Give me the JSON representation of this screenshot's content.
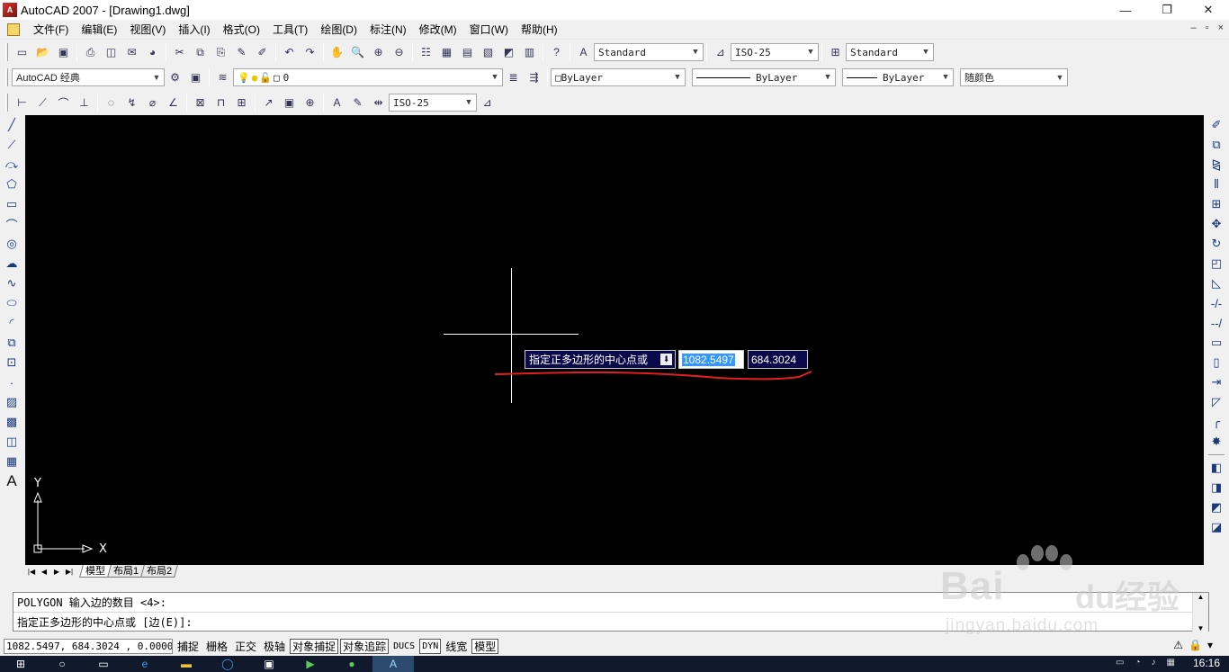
{
  "window": {
    "title": "AutoCAD 2007 - [Drawing1.dwg]",
    "logo_text": "A",
    "minimize": "—",
    "maximize": "❐",
    "close": "✕"
  },
  "menubar": {
    "items": [
      "文件(F)",
      "编辑(E)",
      "视图(V)",
      "插入(I)",
      "格式(O)",
      "工具(T)",
      "绘图(D)",
      "标注(N)",
      "修改(M)",
      "窗口(W)",
      "帮助(H)"
    ],
    "mdi": [
      "–",
      "▫",
      "×"
    ]
  },
  "toolbar": {
    "text_style": "Standard",
    "dim_style": "ISO-25",
    "table_style": "Standard",
    "workspace": "AutoCAD 经典",
    "layer": "0",
    "color": "ByLayer",
    "linetype": "ByLayer",
    "lineweight": "ByLayer",
    "plot_style": "随颜色",
    "dim_style2": "ISO-25"
  },
  "canvas": {
    "dyn_prompt": "指定正多边形的中心点或",
    "dyn_x": "1082.5497",
    "dyn_y": "684.3024",
    "ucs_x": "X",
    "ucs_y": "Y",
    "annotation_color": "#e02020",
    "background": "#000000"
  },
  "tabs": {
    "nav": [
      "|◀",
      "◀",
      "▶",
      "▶|"
    ],
    "items": [
      "模型",
      "布局1",
      "布局2"
    ],
    "active": "模型"
  },
  "command": {
    "line1": "POLYGON 输入边的数目 <4>:",
    "line2": "指定正多边形的中心点或 [边(E)]:"
  },
  "status": {
    "coords": "1082.5497, 684.3024 , 0.0000",
    "toggles": [
      {
        "label": "捕捉",
        "on": false
      },
      {
        "label": "栅格",
        "on": false
      },
      {
        "label": "正交",
        "on": false
      },
      {
        "label": "极轴",
        "on": false
      },
      {
        "label": "对象捕捉",
        "on": true
      },
      {
        "label": "对象追踪",
        "on": true
      },
      {
        "label": "DUCS",
        "on": false
      },
      {
        "label": "DYN",
        "on": true
      },
      {
        "label": "线宽",
        "on": false
      },
      {
        "label": "模型",
        "on": true
      }
    ]
  },
  "taskbar": {
    "clock": "16:16"
  },
  "watermark": {
    "brand": "Bai",
    "brand2": "du经验",
    "url": "jingyan.baidu.com"
  }
}
